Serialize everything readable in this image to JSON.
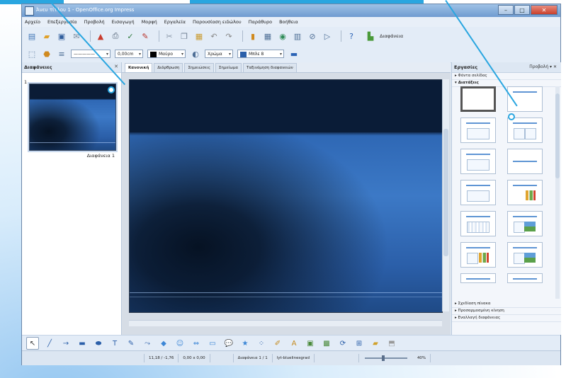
{
  "window": {
    "title": "Άνευ τίτλου 1 - OpenOffice.org Impress"
  },
  "menubar": {
    "items": [
      "Αρχείο",
      "Επεξεργασία",
      "Προβολή",
      "Εισαγωγή",
      "Μορφή",
      "Εργαλεία",
      "Παρουσίαση ειδώλου",
      "Παράθυρο",
      "Βοήθεια"
    ]
  },
  "toolbar": {
    "presentation_label": "Διαφάνεια",
    "line_width": "0,00cm",
    "color_label": "Μαύρο",
    "fill_type": "Χρώμα",
    "fill_color": "Μπλε 8"
  },
  "slides_pane": {
    "title": "Διαφάνειες",
    "slide_number": "1",
    "slide_label": "Διαφάνεια 1"
  },
  "view_tabs": [
    "Κανονική",
    "Διάρθρωση",
    "Σημειώσεις",
    "Σημείωμα",
    "Ταξινόμηση διαφανειών"
  ],
  "tasks_pane": {
    "title": "Εργασίες",
    "view_label": "Προβολή",
    "sections_top": [
      "Φόντα σελίδας",
      "Διατάξεις"
    ],
    "sections_bottom": [
      "Σχεδίαση πίνακα",
      "Προσαρμοσμένη κίνηση",
      "Εναλλαγή διαφάνειας"
    ]
  },
  "statusbar": {
    "position": "11,18 / -1,76",
    "size": "0,00 x 0,00",
    "slide_info": "Διαφάνεια 1 / 1",
    "master": "lyt-bluelinesgrad",
    "zoom": "40%"
  },
  "colors": {
    "accent_callout": "#2aa6e0",
    "slide_dark": "#0a1c37",
    "slide_blue": "#3c79c6"
  }
}
